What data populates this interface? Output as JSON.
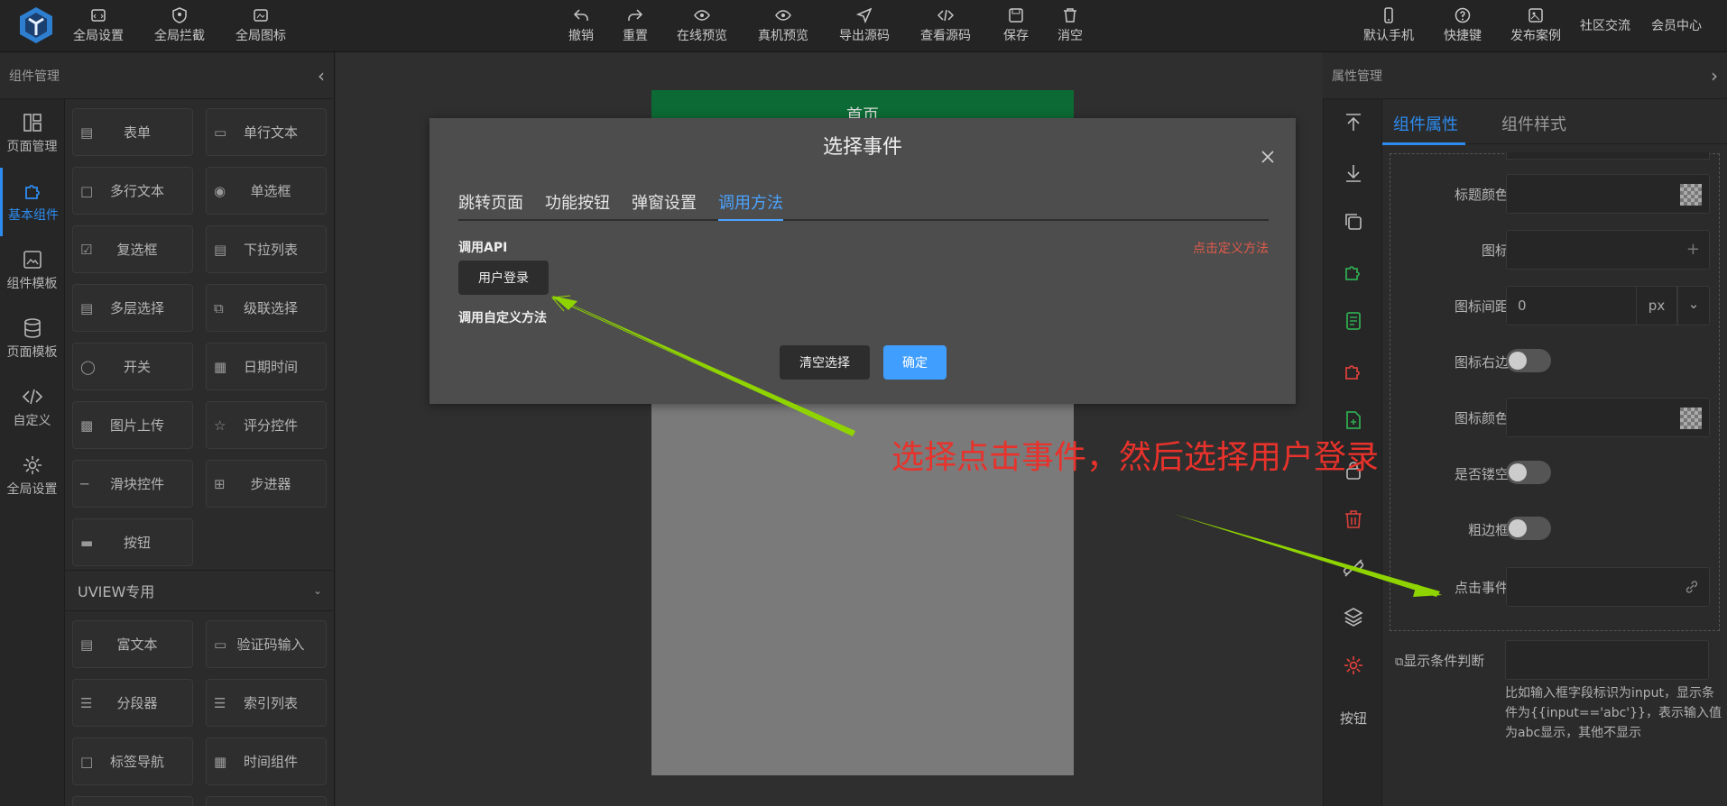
{
  "topbar": {
    "left": [
      "全局设置",
      "全局拦截",
      "全局图标"
    ],
    "center": [
      "撤销",
      "重置",
      "在线预览",
      "真机预览",
      "导出源码",
      "查看源码",
      "保存",
      "消空"
    ],
    "right": [
      "默认手机",
      "快捷键",
      "发布案例",
      "社区交流",
      "会员中心"
    ]
  },
  "left_panel": {
    "title": "组件管理",
    "nav": [
      "页面管理",
      "基本组件",
      "组件模板",
      "页面模板",
      "自定义",
      "全局设置"
    ],
    "components": [
      "表单",
      "单行文本",
      "多行文本",
      "单选框",
      "复选框",
      "下拉列表",
      "多层选择",
      "级联选择",
      "开关",
      "日期时间",
      "图片上传",
      "评分控件",
      "滑块控件",
      "步进器",
      "按钮"
    ],
    "uview_title": "UVIEW专用",
    "uview_components": [
      "富文本",
      "验证码输入",
      "分段器",
      "索引列表",
      "标签导航",
      "时间组件"
    ]
  },
  "phone": {
    "title": "首页"
  },
  "modal": {
    "title": "选择事件",
    "tabs": [
      "跳转页面",
      "功能按钮",
      "弹窗设置",
      "调用方法"
    ],
    "api_label": "调用API",
    "define_link": "点击定义方法",
    "method_button": "用户登录",
    "custom_label": "调用自定义方法",
    "clear_button": "清空选择",
    "confirm_button": "确定"
  },
  "annotation": "选择点击事件，然后选择用户登录",
  "right_toolbar": {
    "label": "按钮"
  },
  "right_panel": {
    "title": "属性管理",
    "tabs": [
      "组件属性",
      "组件样式"
    ],
    "fields": {
      "title_color": "标题颜色:",
      "icon": "图标:",
      "icon_spacing": "图标间距:",
      "icon_spacing_value": "0",
      "icon_spacing_unit": "px",
      "icon_right": "图标右边:",
      "icon_color": "图标颜色:",
      "hollow": "是否镂空:",
      "thick_border": "粗边框:",
      "click_event": "点击事件:"
    },
    "display_condition": "显示条件判断",
    "hint": "比如输入框字段标识为input，显示条件为{{input=='abc'}}，表示输入值为abc显示，其他不显示"
  },
  "colors": {
    "accent": "#2d8cf0",
    "confirm": "#409eff",
    "annotation": "#e8322b",
    "arrow": "#8fd400"
  }
}
